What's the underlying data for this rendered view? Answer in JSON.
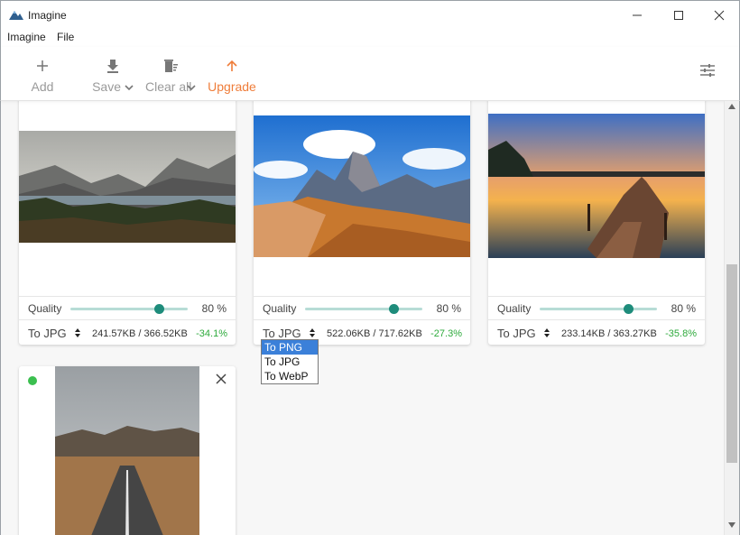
{
  "window": {
    "title": "Imagine",
    "controls": [
      "minimize-icon",
      "maximize-icon",
      "close-icon"
    ]
  },
  "menu": {
    "items": [
      "Imagine",
      "File"
    ]
  },
  "toolbar": {
    "add_label": "Add",
    "save_label": "Save",
    "clear_label": "Clear all",
    "upgrade_label": "Upgrade",
    "accent_color": "#ef7d3a"
  },
  "cards": [
    {
      "quality_label": "Quality",
      "quality": 80,
      "quality_text": "80 %",
      "format": "To JPG",
      "sizes": "241.57KB / 366.52KB",
      "change": "-34.1%"
    },
    {
      "quality_label": "Quality",
      "quality": 80,
      "quality_text": "80 %",
      "format": "To JPG",
      "sizes": "522.06KB / 717.62KB",
      "change": "-27.3%"
    },
    {
      "quality_label": "Quality",
      "quality": 80,
      "quality_text": "80 %",
      "format": "To JPG",
      "sizes": "233.14KB / 363.27KB",
      "change": "-35.8%"
    }
  ],
  "dropdown": {
    "options": [
      "To PNG",
      "To JPG",
      "To WebP"
    ],
    "selected": "To PNG"
  },
  "colors": {
    "slider_track": "#b7dcd6",
    "slider_knob": "#1e8c7b",
    "positive": "#2eaa3c",
    "status_dot": "#3bbf4f",
    "selection": "#3b80d9"
  }
}
